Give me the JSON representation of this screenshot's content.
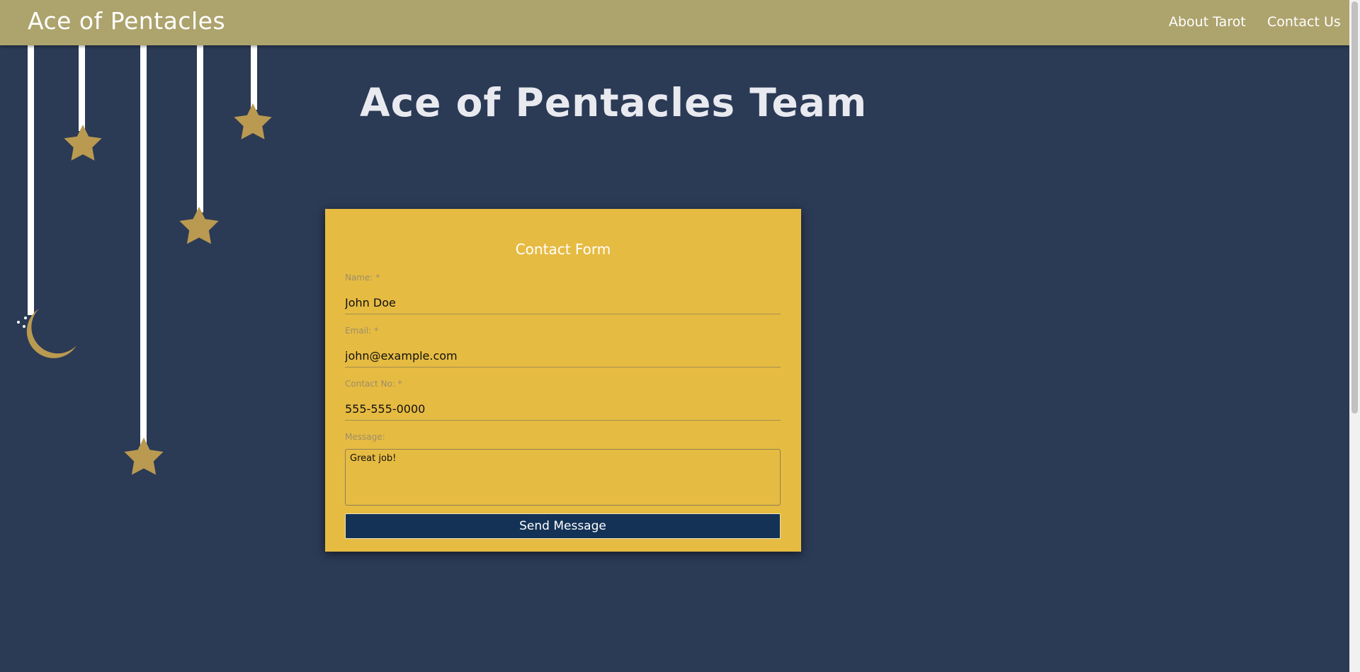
{
  "navbar": {
    "brand": "Ace of Pentacles",
    "links": [
      {
        "label": "About Tarot"
      },
      {
        "label": "Contact Us"
      }
    ]
  },
  "page": {
    "title": "Ace of Pentacles Team"
  },
  "form": {
    "title": "Contact Form",
    "name_label": "Name: *",
    "name_value": "John Doe",
    "email_label": "Email: *",
    "email_value": "john@example.com",
    "contact_label": "Contact No: *",
    "contact_value": "555-555-0000",
    "message_label": "Message:",
    "message_value": "Great job!",
    "submit_label": "Send Message"
  },
  "colors": {
    "background": "#2b3a55",
    "navbar": "#ada36c",
    "form_card": "#e6bb42",
    "button": "#143256",
    "decoration": "#b99a50"
  },
  "icons": [
    "star-icon",
    "moon-icon"
  ]
}
